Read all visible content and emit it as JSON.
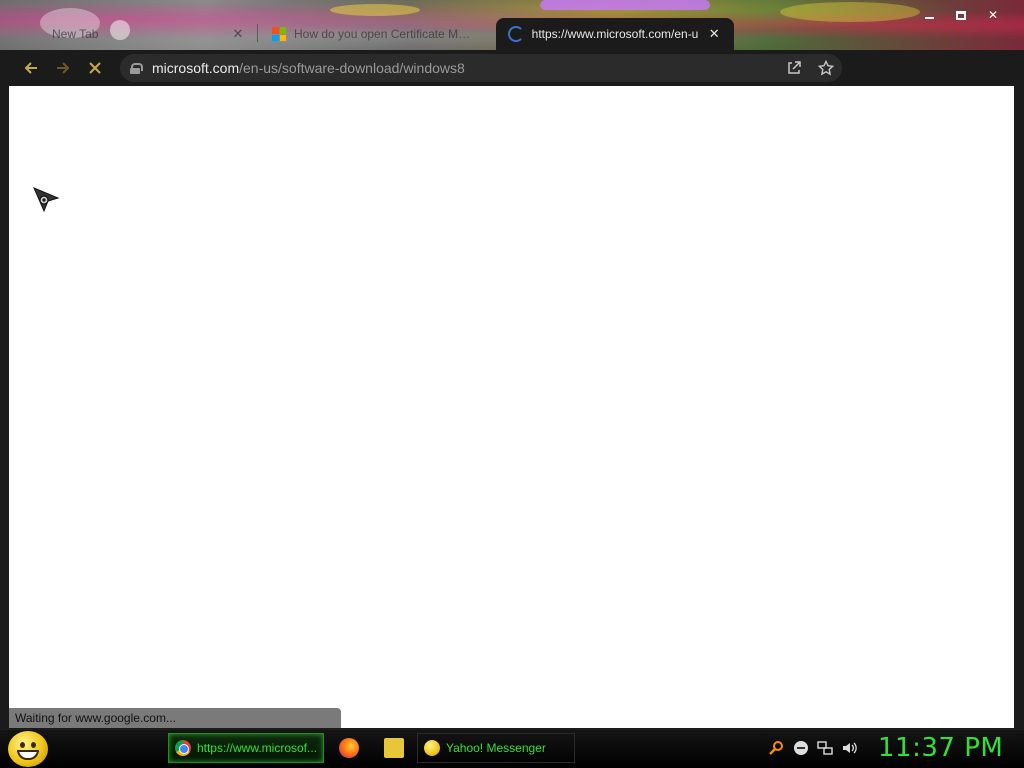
{
  "browser": {
    "tabs": [
      {
        "title": "New Tab",
        "active": false
      },
      {
        "title": "How do you open Certificate Ma...",
        "active": false
      },
      {
        "title": "https://www.microsoft.com/en-u",
        "active": true
      }
    ],
    "close_glyph": "✕",
    "url_host": "microsoft.com",
    "url_path": "/en-us/software-download/windows8",
    "status_text": "Waiting for www.google.com..."
  },
  "taskbar": {
    "tasks": [
      {
        "label": "https://www.microsof...",
        "icon": "chrome-icon"
      },
      {
        "label": "Yahoo! Messenger",
        "icon": "yahoo-messenger-icon"
      }
    ],
    "clock": "11:37 PM"
  },
  "colors": {
    "toolbar_bg": "#1b1b1b",
    "accent_gold": "#c8a94a",
    "taskbar_green": "#33e033"
  }
}
